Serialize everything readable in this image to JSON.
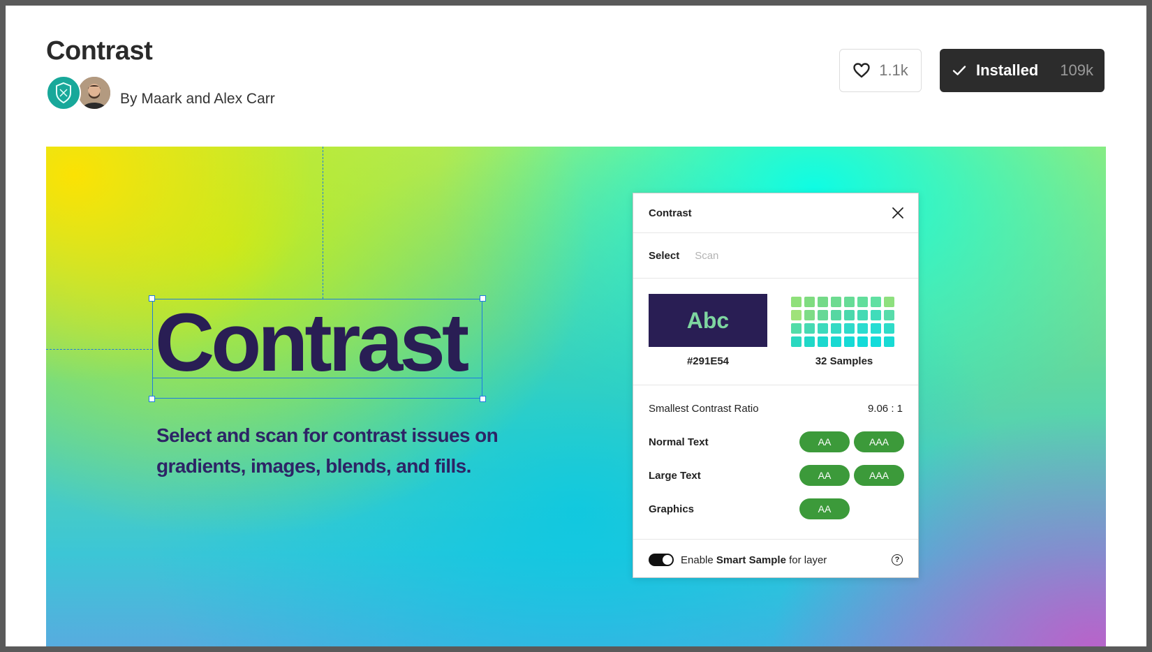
{
  "header": {
    "title": "Contrast",
    "author": "By Maark and Alex Carr",
    "like_count": "1.1k",
    "install_label": "Installed",
    "install_count": "109k"
  },
  "hero": {
    "word": "Contrast",
    "description": "Select and scan for contrast issues on gradients, images, blends, and fills."
  },
  "plugin": {
    "title": "Contrast",
    "tabs": {
      "active": "Select",
      "inactive": "Scan"
    },
    "swatch_text": "Abc",
    "swatch_hex": "#291E54",
    "samples_label": "32 Samples",
    "ratio_label": "Smallest Contrast Ratio",
    "ratio_value": "9.06 : 1",
    "rows": [
      {
        "label": "Normal Text",
        "badges": [
          "AA",
          "AAA"
        ]
      },
      {
        "label": "Large Text",
        "badges": [
          "AA",
          "AAA"
        ]
      },
      {
        "label": "Graphics",
        "badges": [
          "AA"
        ]
      }
    ],
    "footer": {
      "prefix": "Enable",
      "bold": "Smart Sample",
      "suffix": "for layer",
      "help": "?"
    }
  },
  "colors": {
    "text_color": "#291E54",
    "pass_badge": "#3C9A3A",
    "installed_button": "#2C2C2C",
    "selection_blue": "#1F7AE0"
  }
}
